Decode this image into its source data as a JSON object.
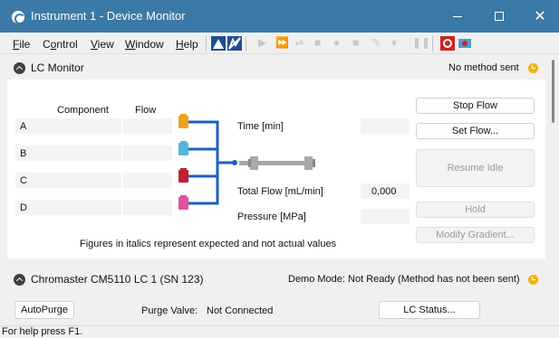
{
  "window": {
    "title": "Instrument 1 - Device Monitor"
  },
  "menu": [
    "File",
    "Control",
    "View",
    "Window",
    "Help"
  ],
  "menu_underline": [
    "F",
    "o",
    "V",
    "W",
    "H"
  ],
  "lc_monitor": {
    "title": "LC Monitor",
    "status": "No method sent",
    "columns": {
      "component": "Component",
      "flow": "Flow"
    },
    "rows": [
      {
        "label": "A",
        "flow": ""
      },
      {
        "label": "B",
        "flow": ""
      },
      {
        "label": "C",
        "flow": ""
      },
      {
        "label": "D",
        "flow": ""
      }
    ],
    "vial_colors": [
      "#f0a020",
      "#50b8d8",
      "#c02030",
      "#e050a0"
    ],
    "time_label": "Time [min]",
    "time_value": "",
    "total_flow_label": "Total Flow [mL/min]",
    "total_flow_value": "0,000",
    "pressure_label": "Pressure [MPa]",
    "pressure_value": "",
    "note": "Figures in italics represent expected and not actual values",
    "buttons": {
      "stop_flow": "Stop Flow",
      "set_flow": "Set Flow...",
      "resume_idle": "Resume Idle",
      "hold": "Hold",
      "modify_gradient": "Modify Gradient..."
    }
  },
  "pump": {
    "title": "Chromaster CM5110 LC 1 (SN 123)",
    "status": "Demo Mode: Not Ready (Method has not been sent)",
    "autopurge": "AutoPurge",
    "purge_valve_label": "Purge Valve:",
    "purge_valve_value": "Not Connected",
    "lc_status": "LC Status..."
  },
  "statusbar": {
    "text": "For help press F1."
  },
  "colors": {
    "titlebar": "#3b79a6",
    "pipe": "#1f5fbf",
    "clock": "#f0b400"
  }
}
